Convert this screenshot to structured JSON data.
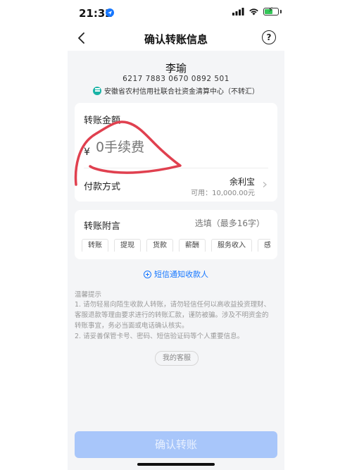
{
  "status_bar": {
    "time": "21:32"
  },
  "nav": {
    "title": "确认转账信息",
    "help": "?"
  },
  "payee": {
    "name": "李瑜",
    "card_number": "6217 7883 0670 0892 501",
    "bank": "安徽省农村信用社联合社资金清算中心（不转汇）"
  },
  "amount": {
    "label": "转账金额",
    "currency": "¥",
    "placeholder": "0手续费"
  },
  "payment_method": {
    "label": "付款方式",
    "name": "余利宝",
    "balance": "可用：10,000.00元"
  },
  "memo": {
    "label": "转账附言",
    "placeholder": "选填（最多16字）",
    "tags": [
      "转账",
      "提现",
      "货款",
      "薪酬",
      "服务收入",
      "感"
    ]
  },
  "sms_notice": {
    "label": "短信通知收款人"
  },
  "tips": {
    "title": "温馨提示",
    "lines": [
      "1. 请勿轻易向陌生收款人转账，请勿轻信任何以高收益投资理财、",
      "客服退款等理由要求进行的转账汇款，谨防被骗。涉及不明资金的",
      "转账事宜，务必当面或电话确认核实。",
      "2. 请妥善保管卡号、密码、短信验证码等个人重要信息。"
    ]
  },
  "customer_service": {
    "label": "我的客服"
  },
  "confirm_button": {
    "label": "确认转账"
  },
  "colors": {
    "accent": "#1677ff",
    "confirm_disabled": "#a8c6fa",
    "scribble": "#e0404f"
  }
}
